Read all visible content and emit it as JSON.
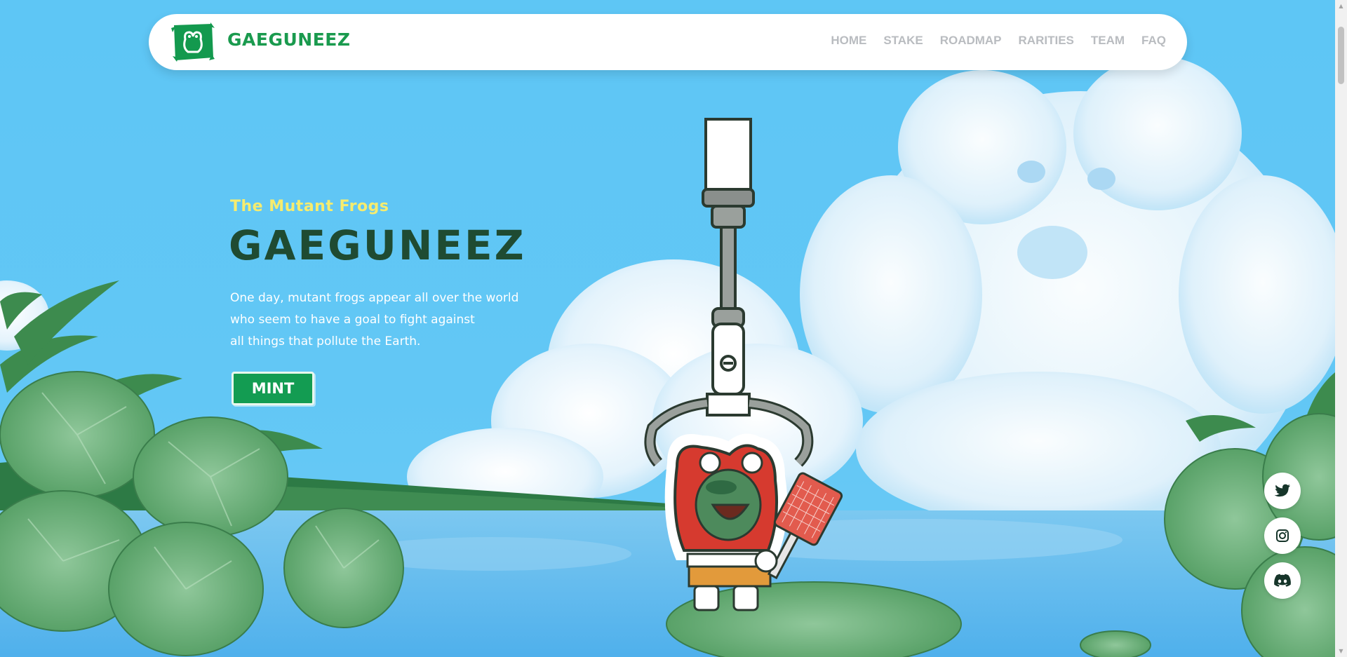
{
  "navbar": {
    "brand": "GAEGUNEEZ",
    "logo_icon": "frog-logo-icon",
    "links": [
      "HOME",
      "STAKE",
      "ROADMAP",
      "RARITIES",
      "TEAM",
      "FAQ"
    ]
  },
  "hero": {
    "subtitle": "The Mutant Frogs",
    "title": "GAEGUNEEZ",
    "description": [
      "One day, mutant frogs appear all over the world",
      "who seem to have a goal to fight against",
      "all things that pollute the Earth."
    ],
    "mint_label": "MINT"
  },
  "social": [
    {
      "icon": "twitter-icon"
    },
    {
      "icon": "instagram-icon"
    },
    {
      "icon": "discord-icon"
    }
  ],
  "colors": {
    "sky": "#5ec6f5",
    "brand_green": "#1a9a4e",
    "title_dark_green": "#1f4b32",
    "subtitle_yellow": "#f6ec6e",
    "nav_gray": "#b9bcc0"
  }
}
